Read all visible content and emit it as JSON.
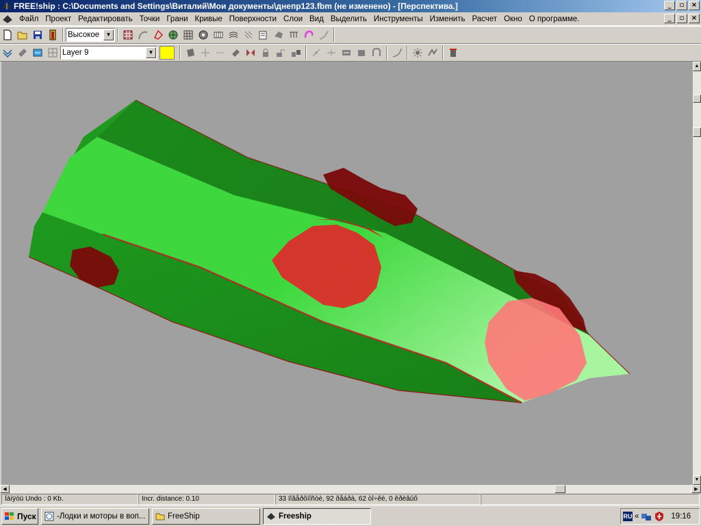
{
  "window": {
    "title": "FREE!ship   : C:\\Documents and Settings\\Виталий\\Мои документы\\днепр123.fbm (не изменено) - [Перспектива.]"
  },
  "menu": [
    "Файл",
    "Проект",
    "Редактировать",
    "Точки",
    "Грани",
    "Кривые",
    "Поверхности",
    "Слои",
    "Вид",
    "Выделить",
    "Инструменты",
    "Изменить",
    "Расчет",
    "Окно",
    "О программе."
  ],
  "toolbar": {
    "precision_value": "Высокое",
    "layer_value": "Layer 9",
    "layer_color": "#ffff00"
  },
  "statusbar": {
    "undo": "Ïàìÿòü Undo : 0 Kb.",
    "incr": "Incr. distance: 0.10",
    "counts": "33 ïîâåðõíîñòè, 92 ðåáðà, 62 òî÷êè, 0 êðèâûõ"
  },
  "taskbar": {
    "start_label": "Пуск",
    "tasks": [
      "-Лодки и моторы в воп...",
      "FreeShip",
      "Freeship"
    ],
    "tray_lang": "RU",
    "tray_arrows": "«",
    "clock": "19:16"
  },
  "colors": {
    "title_bar": "#0a246a",
    "viewport_bg": "#a0a0a0",
    "hull_dark_green": "#1e8c1e",
    "hull_light_green": "#4ee04e",
    "hull_red": "#e02828",
    "hull_dark_red": "#7a0a0a",
    "hull_pink": "#ff8080"
  }
}
